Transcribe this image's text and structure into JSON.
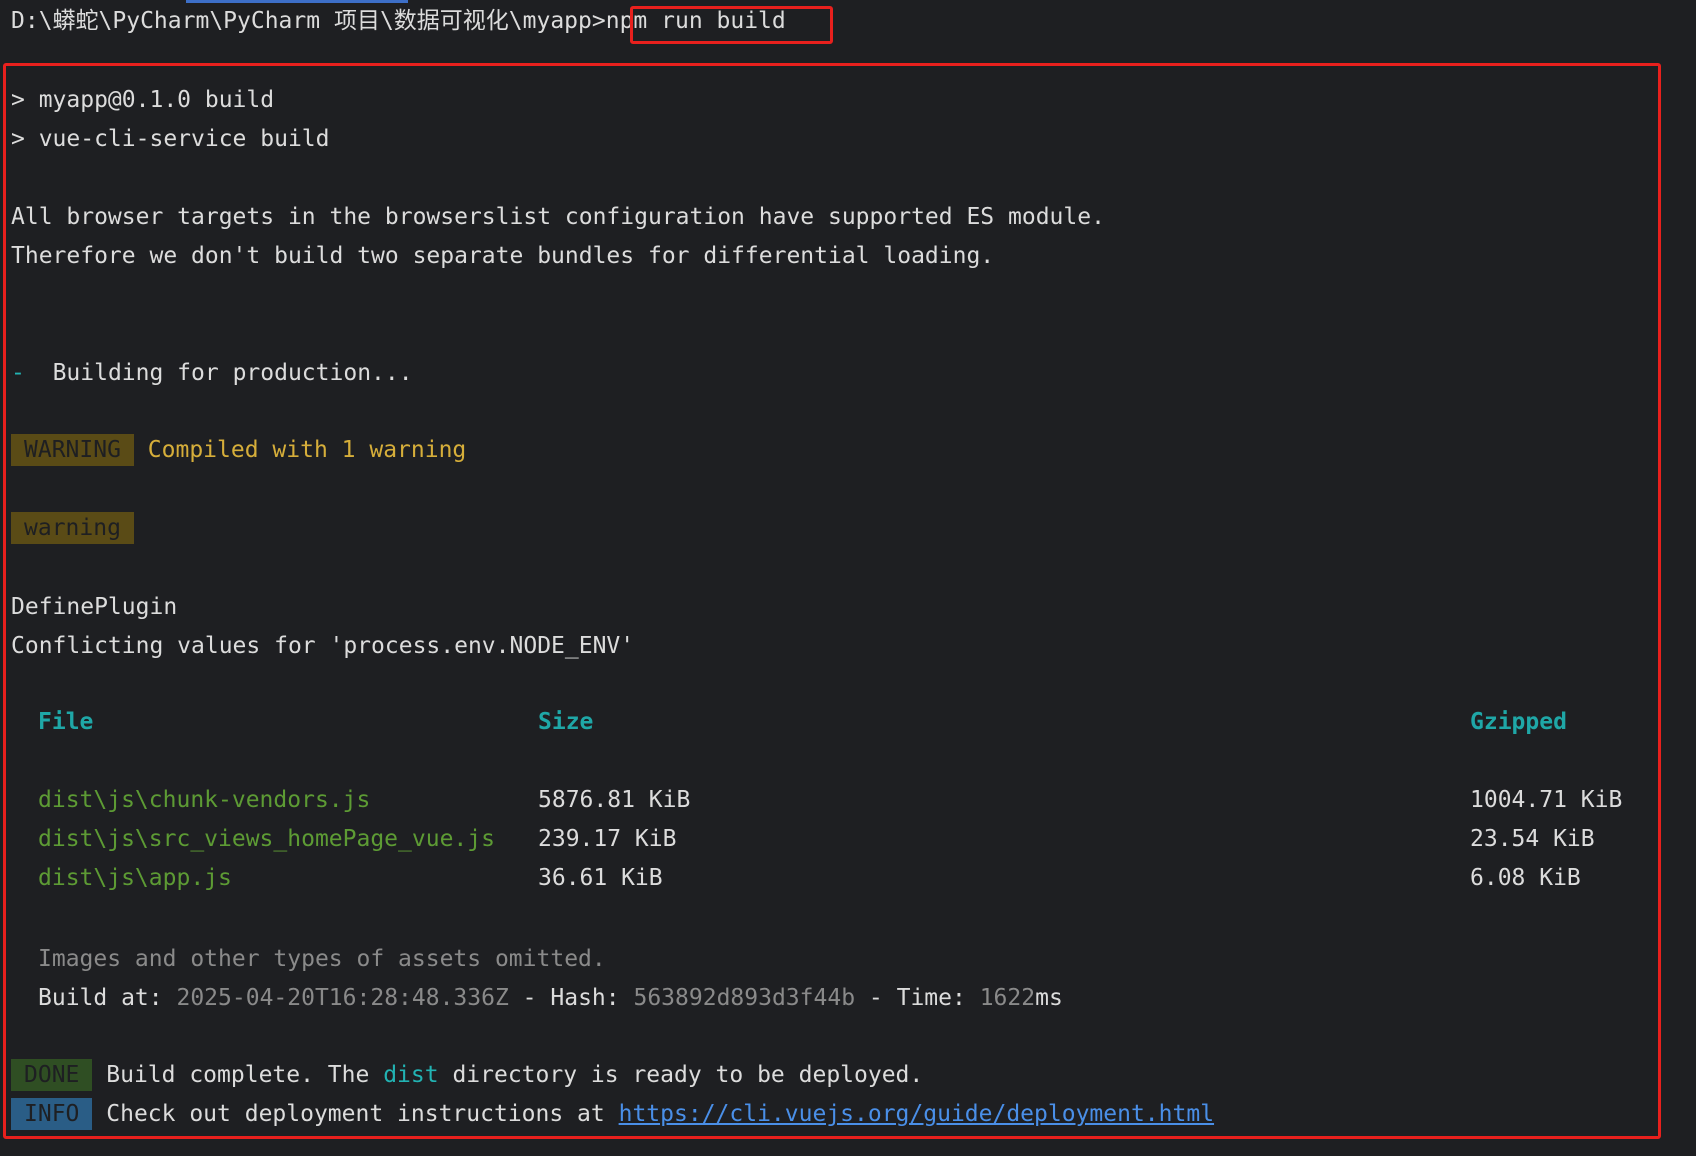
{
  "prompt": {
    "path": "D:\\蟒蛇\\PyCharm\\PyCharm 项目\\数据可视化\\myapp>",
    "command": "npm run build"
  },
  "output": {
    "script_line_1": "> myapp@0.1.0 build",
    "script_line_2": "> vue-cli-service build",
    "browser_line_1": "All browser targets in the browserslist configuration have supported ES module.",
    "browser_line_2": "Therefore we don't build two separate bundles for differential loading.",
    "spinner_glyph": "-",
    "building_text": "Building for production...",
    "warning_badge": "WARNING",
    "warning_summary": "Compiled with 1 warning",
    "warning_label": "warning",
    "plugin_name": "DefinePlugin",
    "plugin_message": "Conflicting values for 'process.env.NODE_ENV'",
    "table": {
      "headers": [
        "File",
        "Size",
        "Gzipped"
      ],
      "rows": [
        {
          "file": "dist\\js\\chunk-vendors.js",
          "size": "5876.81 KiB",
          "gzipped": "1004.71 KiB"
        },
        {
          "file": "dist\\js\\src_views_homePage_vue.js",
          "size": "239.17 KiB",
          "gzipped": "23.54 KiB"
        },
        {
          "file": "dist\\js\\app.js",
          "size": "36.61 KiB",
          "gzipped": "6.08 KiB"
        }
      ]
    },
    "omitted_note": "Images and other types of assets omitted.",
    "build_info": {
      "build_at_label": "Build at:",
      "build_at_value": "2025-04-20T16:28:48.336Z",
      "sep1": " - ",
      "hash_label": "Hash:",
      "hash_value": "563892d893d3f44b",
      "sep2": " - ",
      "time_label": "Time:",
      "time_value": "1622",
      "time_unit": "ms"
    },
    "done_badge": "DONE",
    "done_text_1": "Build complete. The ",
    "done_dist": "dist",
    "done_text_2": " directory is ready to be deployed.",
    "info_badge": "INFO",
    "info_text": "Check out deployment instructions at ",
    "info_link": "https://cli.vuejs.org/guide/deployment.html"
  },
  "colors": {
    "background": "#1e1f22",
    "highlight_box": "#e8201d",
    "file_green": "#5d9b34",
    "header_teal": "#1fa7a7",
    "warning_yellow": "#d6ae3a",
    "link_blue": "#4a8fe8"
  }
}
